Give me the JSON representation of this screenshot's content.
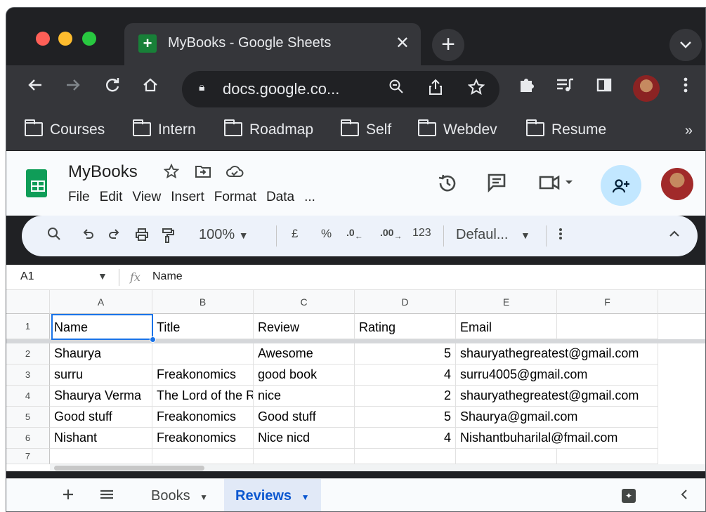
{
  "browser": {
    "tab_title": "MyBooks - Google Sheets",
    "tab_close": "✕",
    "new_tab": "+",
    "tab_menu": "⌄",
    "url": "docs.google.co...",
    "bookmarks": [
      "Courses",
      "Intern",
      "Roadmap",
      "Self",
      "Webdev",
      "Resume"
    ],
    "bookmarks_more": "»"
  },
  "sheets": {
    "title": "MyBooks",
    "menu": [
      "File",
      "Edit",
      "View",
      "Insert",
      "Format",
      "Data",
      "..."
    ],
    "zoom": "100%",
    "currency": "£",
    "percent": "%",
    "dec_decrease": ".0←",
    "dec_increase": ".00→",
    "number_format": "123",
    "font": "Defaul...",
    "name_box": "A1",
    "formula": "Name",
    "columns": [
      "A",
      "B",
      "C",
      "D",
      "E",
      "F"
    ],
    "rows": [
      {
        "num": "1",
        "cells": [
          "Name",
          "Title",
          "Review",
          "Rating",
          "Email",
          ""
        ]
      },
      {
        "num": "2",
        "cells": [
          "Shaurya",
          "",
          "Awesome",
          "5",
          "shauryathegreatest@gmail.com",
          ""
        ]
      },
      {
        "num": "3",
        "cells": [
          "surru",
          "Freakonomics",
          "good book",
          "4",
          "surru4005@gmail.com",
          ""
        ]
      },
      {
        "num": "4",
        "cells": [
          "Shaurya Verma",
          "The Lord of the R",
          "nice",
          "2",
          "shauryathegreatest@gmail.com",
          ""
        ]
      },
      {
        "num": "5",
        "cells": [
          "Good stuff",
          "Freakonomics",
          "Good stuff",
          "5",
          "Shaurya@gmail.com",
          ""
        ]
      },
      {
        "num": "6",
        "cells": [
          "Nishant",
          "Freakonomics",
          "Nice nicd",
          "4",
          "Nishantbuharilal@fmail.com",
          ""
        ]
      },
      {
        "num": "7",
        "cells": [
          "",
          "",
          "",
          "",
          "",
          ""
        ]
      }
    ],
    "sheet_tabs": [
      {
        "label": "Books",
        "active": false
      },
      {
        "label": "Reviews",
        "active": true
      }
    ]
  },
  "colors": {
    "accent": "#1a73e8",
    "sheets_green": "#0f9d58",
    "chrome_dark": "#202124",
    "share_bg": "#c2e7ff"
  }
}
